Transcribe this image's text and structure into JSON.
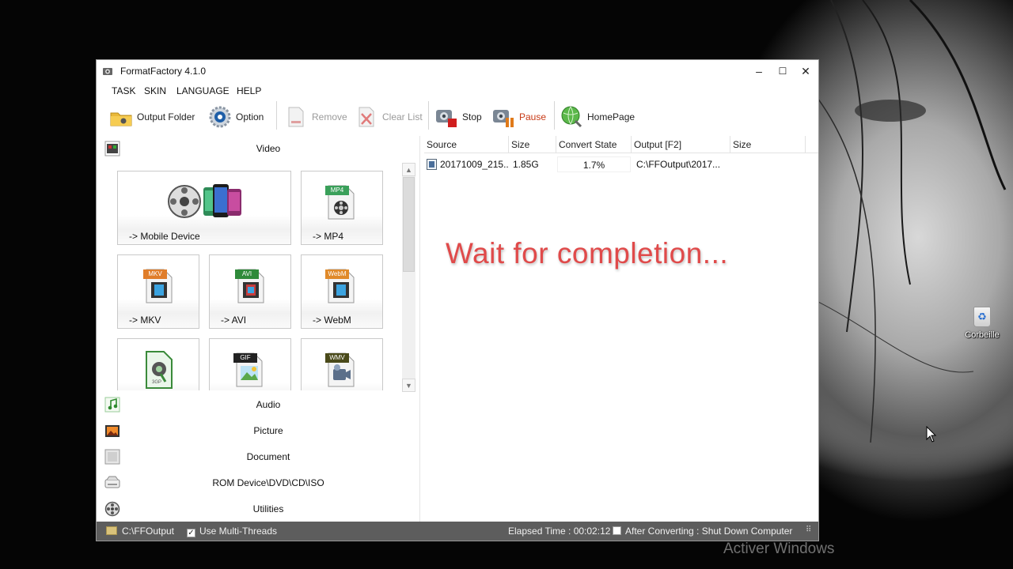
{
  "window": {
    "title": "FormatFactory 4.1.0",
    "controls": {
      "minimize": "–",
      "maximize": "☐",
      "close": "✕"
    }
  },
  "menu": [
    "TASK",
    "SKIN",
    "LANGUAGE",
    "HELP"
  ],
  "toolbar": {
    "output_folder": "Output Folder",
    "option": "Option",
    "remove": "Remove",
    "clear_list": "Clear List",
    "stop": "Stop",
    "pause": "Pause",
    "homepage": "HomePage"
  },
  "categories": {
    "video": "Video",
    "audio": "Audio",
    "picture": "Picture",
    "document": "Document",
    "rom": "ROM Device\\DVD\\CD\\ISO",
    "utilities": "Utilities"
  },
  "tiles": {
    "mobile": "-> Mobile Device",
    "mp4": "-> MP4",
    "mkv": "-> MKV",
    "avi": "-> AVI",
    "webm": "-> WebM"
  },
  "tile_badges": {
    "mp4": "MP4",
    "mkv": "MKV",
    "avi": "AVI",
    "webm": "WebM",
    "gif": "GIF",
    "wmv": "WMV",
    "3gp": "3GP"
  },
  "task_list": {
    "headers": [
      "Source",
      "Size",
      "Convert State",
      "Output [F2]",
      "Size"
    ],
    "rows": [
      {
        "source": "20171009_215...",
        "size": "1.85G",
        "state": "1.7%",
        "output": "C:\\FFOutput\\2017...",
        "out_size": ""
      }
    ],
    "overlay": "Wait for completion..."
  },
  "statusbar": {
    "folder": "C:\\FFOutput",
    "multithread": "Use Multi-Threads",
    "multithread_checked": true,
    "elapsed": "Elapsed Time : 00:02:12",
    "after_converting": "After Converting : Shut Down Computer",
    "after_checked": false
  },
  "desktop": {
    "recycle_bin": "Corbeille",
    "watermark": "Activer Windows"
  },
  "colors": {
    "pause": "#c83a16",
    "overlay": "#e04a4a",
    "statusbar": "#5d5d5d"
  }
}
